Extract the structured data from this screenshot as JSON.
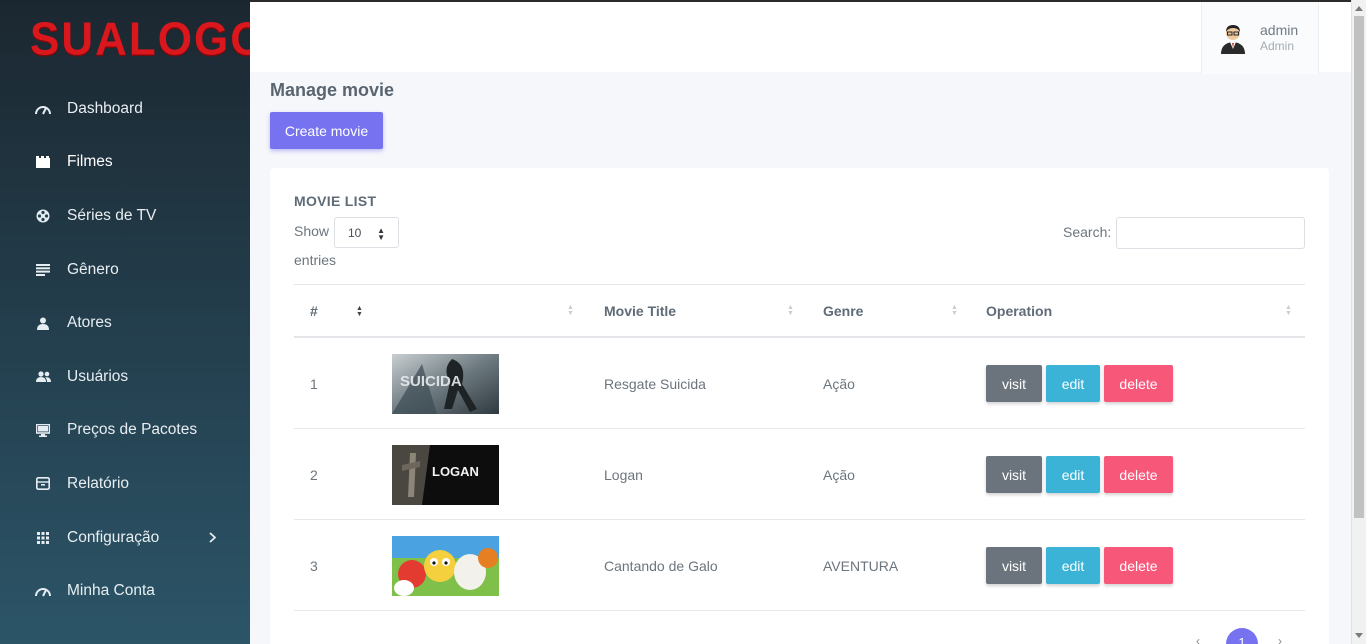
{
  "brand": {
    "logo_text": "SUALOGO",
    "color": "#d9171d"
  },
  "sidebar": {
    "items": [
      {
        "label": "Dashboard",
        "icon": "speedometer-icon"
      },
      {
        "label": "Filmes",
        "icon": "clapperboard-icon",
        "active": true
      },
      {
        "label": "Séries de TV",
        "icon": "film-reel-icon"
      },
      {
        "label": "Gênero",
        "icon": "list-icon"
      },
      {
        "label": "Atores",
        "icon": "person-icon"
      },
      {
        "label": "Usuários",
        "icon": "people-icon"
      },
      {
        "label": "Preços de Pacotes",
        "icon": "monitor-icon"
      },
      {
        "label": "Relatório",
        "icon": "inbox-icon"
      },
      {
        "label": "Configuração",
        "icon": "grid-icon",
        "has_submenu": true
      },
      {
        "label": "Minha Conta",
        "icon": "speedometer-icon"
      }
    ]
  },
  "user": {
    "name": "admin",
    "role": "Admin"
  },
  "page": {
    "title": "Manage movie",
    "create_button": "Create movie"
  },
  "table": {
    "title": "MOVIE LIST",
    "show_label": "Show",
    "entries_label": "entries",
    "page_length": "10",
    "search_label": "Search:",
    "search_value": "",
    "columns": [
      "#",
      "",
      "Movie Title",
      "Genre",
      "Operation"
    ],
    "rows": [
      {
        "num": "1",
        "title": "Resgate Suicida",
        "genre": "Ação",
        "thumb_text": "SUICIDA"
      },
      {
        "num": "2",
        "title": "Logan",
        "genre": "Ação",
        "thumb_text": "LOGAN"
      },
      {
        "num": "3",
        "title": "Cantando de Galo",
        "genre": "AVENTURA",
        "thumb_text": ""
      }
    ],
    "buttons": {
      "visit": "visit",
      "edit": "edit",
      "delete": "delete"
    },
    "current_page": "1"
  },
  "colors": {
    "primary": "#7672f0",
    "visit": "#6b747c",
    "edit": "#3bb3d6",
    "delete": "#f7587a"
  }
}
